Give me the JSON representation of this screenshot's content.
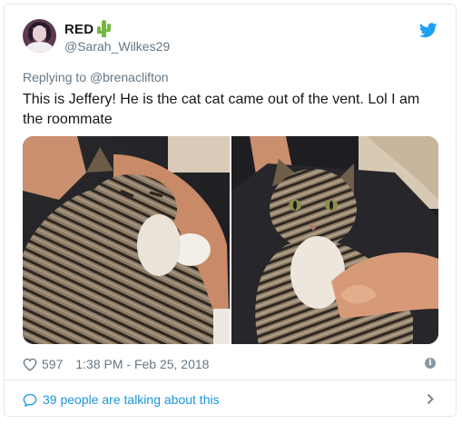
{
  "user": {
    "display_name": "RED",
    "handle": "@Sarah_Wilkes29",
    "emoji_icon": "cactus-icon"
  },
  "reply": {
    "prefix": "Replying to",
    "to_handle": "@brenaclifton"
  },
  "tweet": {
    "text": "This is Jeffery! He is the cat cat came out of the vent. Lol I am the roommate"
  },
  "media": {
    "photos": [
      "cat-photo-1",
      "cat-photo-2"
    ]
  },
  "stats": {
    "likes": "597",
    "timestamp": "1:38 PM - Feb 25, 2018"
  },
  "conversation": {
    "label": "39 people are talking about this"
  },
  "colors": {
    "brand_blue": "#1da1f2",
    "link_blue": "#1b95e0",
    "muted": "#657786",
    "border": "#e1e8ed",
    "cactus_green": "#74b843"
  }
}
